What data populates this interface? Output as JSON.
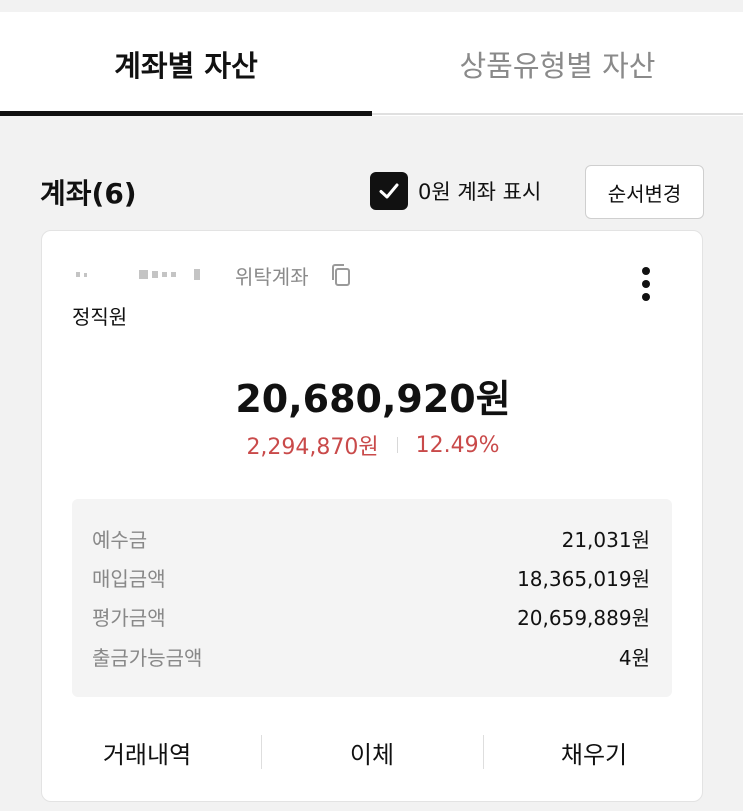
{
  "tabs": {
    "account_assets": "계좌별 자산",
    "product_assets": "상품유형별 자산"
  },
  "account_header": {
    "title": "계좌(6)",
    "zero_balance_label": "0원 계좌 표시",
    "zero_balance_checked": true,
    "order_change": "순서변경"
  },
  "account_card": {
    "account_type": "위탁계좌",
    "account_name": "정직원",
    "total_value": "20,680,920원",
    "profit_amount": "2,294,870원",
    "profit_rate": "12.49%",
    "details": [
      {
        "label": "예수금",
        "value": "21,031원"
      },
      {
        "label": "매입금액",
        "value": "18,365,019원"
      },
      {
        "label": "평가금액",
        "value": "20,659,889원"
      },
      {
        "label": "출금가능금액",
        "value": "4원"
      }
    ],
    "actions": {
      "history": "거래내역",
      "transfer": "이체",
      "fill": "채우기"
    }
  },
  "colors": {
    "accent_dark": "#111111",
    "profit_red": "#c94a4a",
    "muted_gray": "#888888"
  }
}
